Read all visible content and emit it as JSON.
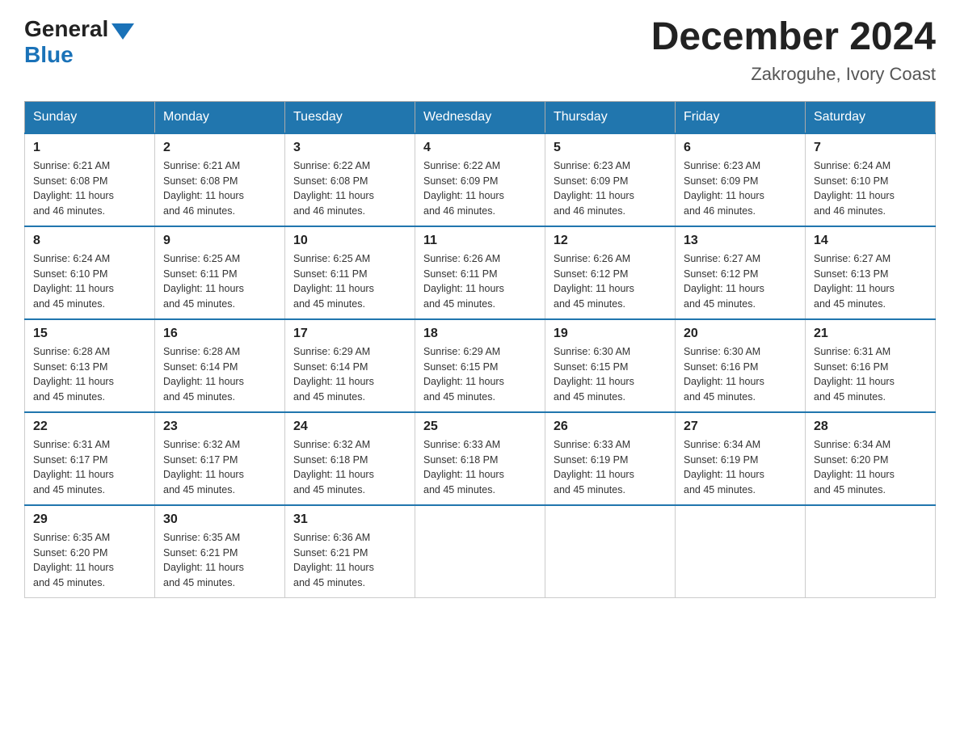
{
  "header": {
    "logo_general": "General",
    "logo_blue": "Blue",
    "month_title": "December 2024",
    "location": "Zakroguhe, Ivory Coast"
  },
  "days_of_week": [
    "Sunday",
    "Monday",
    "Tuesday",
    "Wednesday",
    "Thursday",
    "Friday",
    "Saturday"
  ],
  "weeks": [
    [
      {
        "day": "1",
        "sunrise": "6:21 AM",
        "sunset": "6:08 PM",
        "daylight": "11 hours and 46 minutes."
      },
      {
        "day": "2",
        "sunrise": "6:21 AM",
        "sunset": "6:08 PM",
        "daylight": "11 hours and 46 minutes."
      },
      {
        "day": "3",
        "sunrise": "6:22 AM",
        "sunset": "6:08 PM",
        "daylight": "11 hours and 46 minutes."
      },
      {
        "day": "4",
        "sunrise": "6:22 AM",
        "sunset": "6:09 PM",
        "daylight": "11 hours and 46 minutes."
      },
      {
        "day": "5",
        "sunrise": "6:23 AM",
        "sunset": "6:09 PM",
        "daylight": "11 hours and 46 minutes."
      },
      {
        "day": "6",
        "sunrise": "6:23 AM",
        "sunset": "6:09 PM",
        "daylight": "11 hours and 46 minutes."
      },
      {
        "day": "7",
        "sunrise": "6:24 AM",
        "sunset": "6:10 PM",
        "daylight": "11 hours and 46 minutes."
      }
    ],
    [
      {
        "day": "8",
        "sunrise": "6:24 AM",
        "sunset": "6:10 PM",
        "daylight": "11 hours and 45 minutes."
      },
      {
        "day": "9",
        "sunrise": "6:25 AM",
        "sunset": "6:11 PM",
        "daylight": "11 hours and 45 minutes."
      },
      {
        "day": "10",
        "sunrise": "6:25 AM",
        "sunset": "6:11 PM",
        "daylight": "11 hours and 45 minutes."
      },
      {
        "day": "11",
        "sunrise": "6:26 AM",
        "sunset": "6:11 PM",
        "daylight": "11 hours and 45 minutes."
      },
      {
        "day": "12",
        "sunrise": "6:26 AM",
        "sunset": "6:12 PM",
        "daylight": "11 hours and 45 minutes."
      },
      {
        "day": "13",
        "sunrise": "6:27 AM",
        "sunset": "6:12 PM",
        "daylight": "11 hours and 45 minutes."
      },
      {
        "day": "14",
        "sunrise": "6:27 AM",
        "sunset": "6:13 PM",
        "daylight": "11 hours and 45 minutes."
      }
    ],
    [
      {
        "day": "15",
        "sunrise": "6:28 AM",
        "sunset": "6:13 PM",
        "daylight": "11 hours and 45 minutes."
      },
      {
        "day": "16",
        "sunrise": "6:28 AM",
        "sunset": "6:14 PM",
        "daylight": "11 hours and 45 minutes."
      },
      {
        "day": "17",
        "sunrise": "6:29 AM",
        "sunset": "6:14 PM",
        "daylight": "11 hours and 45 minutes."
      },
      {
        "day": "18",
        "sunrise": "6:29 AM",
        "sunset": "6:15 PM",
        "daylight": "11 hours and 45 minutes."
      },
      {
        "day": "19",
        "sunrise": "6:30 AM",
        "sunset": "6:15 PM",
        "daylight": "11 hours and 45 minutes."
      },
      {
        "day": "20",
        "sunrise": "6:30 AM",
        "sunset": "6:16 PM",
        "daylight": "11 hours and 45 minutes."
      },
      {
        "day": "21",
        "sunrise": "6:31 AM",
        "sunset": "6:16 PM",
        "daylight": "11 hours and 45 minutes."
      }
    ],
    [
      {
        "day": "22",
        "sunrise": "6:31 AM",
        "sunset": "6:17 PM",
        "daylight": "11 hours and 45 minutes."
      },
      {
        "day": "23",
        "sunrise": "6:32 AM",
        "sunset": "6:17 PM",
        "daylight": "11 hours and 45 minutes."
      },
      {
        "day": "24",
        "sunrise": "6:32 AM",
        "sunset": "6:18 PM",
        "daylight": "11 hours and 45 minutes."
      },
      {
        "day": "25",
        "sunrise": "6:33 AM",
        "sunset": "6:18 PM",
        "daylight": "11 hours and 45 minutes."
      },
      {
        "day": "26",
        "sunrise": "6:33 AM",
        "sunset": "6:19 PM",
        "daylight": "11 hours and 45 minutes."
      },
      {
        "day": "27",
        "sunrise": "6:34 AM",
        "sunset": "6:19 PM",
        "daylight": "11 hours and 45 minutes."
      },
      {
        "day": "28",
        "sunrise": "6:34 AM",
        "sunset": "6:20 PM",
        "daylight": "11 hours and 45 minutes."
      }
    ],
    [
      {
        "day": "29",
        "sunrise": "6:35 AM",
        "sunset": "6:20 PM",
        "daylight": "11 hours and 45 minutes."
      },
      {
        "day": "30",
        "sunrise": "6:35 AM",
        "sunset": "6:21 PM",
        "daylight": "11 hours and 45 minutes."
      },
      {
        "day": "31",
        "sunrise": "6:36 AM",
        "sunset": "6:21 PM",
        "daylight": "11 hours and 45 minutes."
      },
      null,
      null,
      null,
      null
    ]
  ]
}
